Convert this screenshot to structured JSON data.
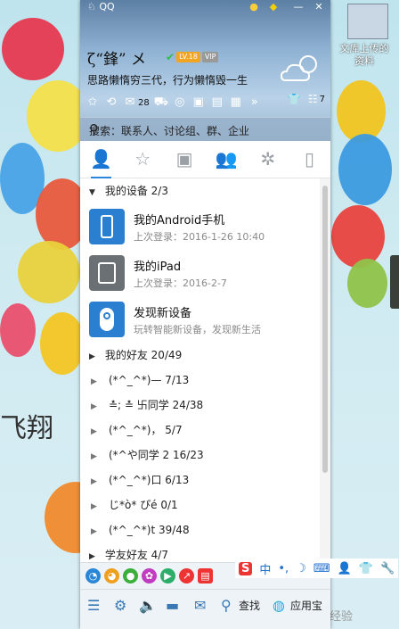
{
  "window": {
    "title": "QQ"
  },
  "profile": {
    "nickname": "ζ“鋒” メ",
    "level_badge": "LV.18",
    "vip_badge": "VIP",
    "signature": "思路懒惰穷三代，行为懒惰毁一生"
  },
  "toolbar": {
    "mail_count": "28",
    "msg_count": "7"
  },
  "search": {
    "placeholder": "搜索：联系人、讨论组、群、企业"
  },
  "tabs": [
    {
      "icon": "contacts-icon"
    },
    {
      "icon": "favorite-star-icon"
    },
    {
      "icon": "chat-bubble-icon"
    },
    {
      "icon": "group-icon"
    },
    {
      "icon": "apps-icon"
    },
    {
      "icon": "phone-icon"
    }
  ],
  "my_devices": {
    "label": "我的设备",
    "count": "2/3"
  },
  "devices": [
    {
      "name": "我的Android手机",
      "desc": "上次登录：2016-1-26 10:40",
      "color": "#2a7fd0"
    },
    {
      "name": "我的iPad",
      "desc": "上次登录：2016-2-7",
      "color": "#6b7075"
    },
    {
      "name": "发现新设备",
      "desc": "玩转智能新设备，发现新生活",
      "color": "#2a7fd0"
    }
  ],
  "my_friends": {
    "label": "我的好友",
    "count": "20/49"
  },
  "subgroups": [
    {
      "label": "(*^_^*)— 7/13"
    },
    {
      "label": "≛; ≛ 卐同学 24/38"
    },
    {
      "label": "(*^_^*)， 5/7"
    },
    {
      "label": "(*^や同学    2      16/23"
    },
    {
      "label": "(*^_^*)口 6/13"
    },
    {
      "label": "じ*ò* ぴé 0/1"
    },
    {
      "label": "(*^_^*)t 39/48"
    }
  ],
  "classmates": {
    "label": "学友好友",
    "count": "4/7"
  },
  "bottom": {
    "find_label": "查找",
    "app_label": "应用宝"
  },
  "desktop": {
    "file_label_1": "文库上传的",
    "file_label_2": "资料",
    "art_text": "飞翔",
    "watermark": "经验"
  },
  "ime": {
    "lang": "中"
  }
}
